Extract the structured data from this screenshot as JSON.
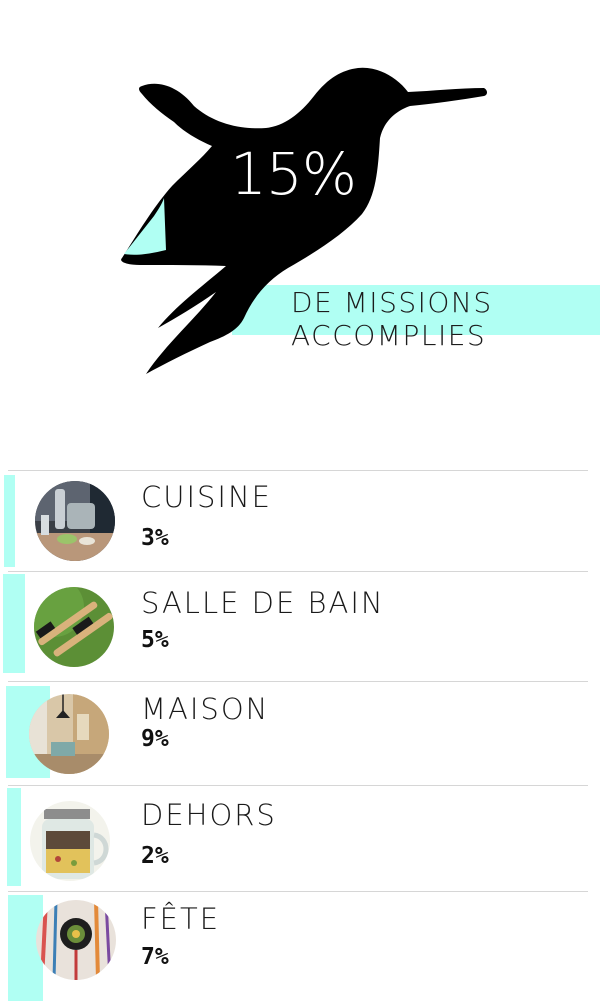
{
  "colors": {
    "accent": "#b0fff3",
    "bird": "#000000"
  },
  "hero": {
    "icon": "hummingbird-icon",
    "percent": "15%",
    "caption_line1": "DE MISSIONS",
    "caption_line2": "ACCOMPLIES"
  },
  "categories": [
    {
      "name": "CUISINE",
      "value": "3%",
      "image": "kitchen-photo"
    },
    {
      "name": "SALLE DE BAIN",
      "value": "5%",
      "image": "toothbrush-photo"
    },
    {
      "name": "MAISON",
      "value": "9%",
      "image": "home-interior-photo"
    },
    {
      "name": "DEHORS",
      "value": "2%",
      "image": "jar-photo"
    },
    {
      "name": "FÊTE",
      "value": "7%",
      "image": "party-decoration-photo"
    }
  ]
}
